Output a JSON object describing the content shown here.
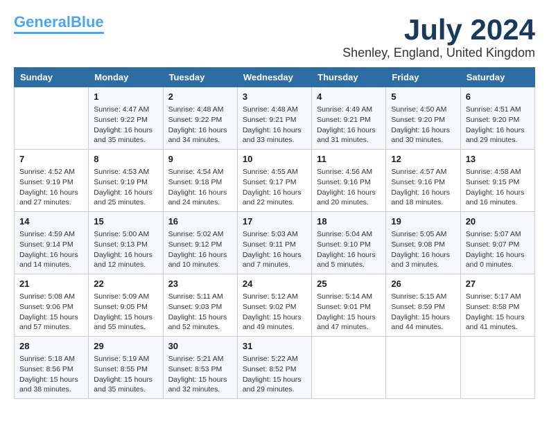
{
  "header": {
    "logo_line1": "General",
    "logo_line2": "Blue",
    "month": "July 2024",
    "location": "Shenley, England, United Kingdom"
  },
  "days_of_week": [
    "Sunday",
    "Monday",
    "Tuesday",
    "Wednesday",
    "Thursday",
    "Friday",
    "Saturday"
  ],
  "weeks": [
    [
      {
        "day": "",
        "content": ""
      },
      {
        "day": "1",
        "content": "Sunrise: 4:47 AM\nSunset: 9:22 PM\nDaylight: 16 hours\nand 35 minutes."
      },
      {
        "day": "2",
        "content": "Sunrise: 4:48 AM\nSunset: 9:22 PM\nDaylight: 16 hours\nand 34 minutes."
      },
      {
        "day": "3",
        "content": "Sunrise: 4:48 AM\nSunset: 9:21 PM\nDaylight: 16 hours\nand 33 minutes."
      },
      {
        "day": "4",
        "content": "Sunrise: 4:49 AM\nSunset: 9:21 PM\nDaylight: 16 hours\nand 31 minutes."
      },
      {
        "day": "5",
        "content": "Sunrise: 4:50 AM\nSunset: 9:20 PM\nDaylight: 16 hours\nand 30 minutes."
      },
      {
        "day": "6",
        "content": "Sunrise: 4:51 AM\nSunset: 9:20 PM\nDaylight: 16 hours\nand 29 minutes."
      }
    ],
    [
      {
        "day": "7",
        "content": "Sunrise: 4:52 AM\nSunset: 9:19 PM\nDaylight: 16 hours\nand 27 minutes."
      },
      {
        "day": "8",
        "content": "Sunrise: 4:53 AM\nSunset: 9:19 PM\nDaylight: 16 hours\nand 25 minutes."
      },
      {
        "day": "9",
        "content": "Sunrise: 4:54 AM\nSunset: 9:18 PM\nDaylight: 16 hours\nand 24 minutes."
      },
      {
        "day": "10",
        "content": "Sunrise: 4:55 AM\nSunset: 9:17 PM\nDaylight: 16 hours\nand 22 minutes."
      },
      {
        "day": "11",
        "content": "Sunrise: 4:56 AM\nSunset: 9:16 PM\nDaylight: 16 hours\nand 20 minutes."
      },
      {
        "day": "12",
        "content": "Sunrise: 4:57 AM\nSunset: 9:16 PM\nDaylight: 16 hours\nand 18 minutes."
      },
      {
        "day": "13",
        "content": "Sunrise: 4:58 AM\nSunset: 9:15 PM\nDaylight: 16 hours\nand 16 minutes."
      }
    ],
    [
      {
        "day": "14",
        "content": "Sunrise: 4:59 AM\nSunset: 9:14 PM\nDaylight: 16 hours\nand 14 minutes."
      },
      {
        "day": "15",
        "content": "Sunrise: 5:00 AM\nSunset: 9:13 PM\nDaylight: 16 hours\nand 12 minutes."
      },
      {
        "day": "16",
        "content": "Sunrise: 5:02 AM\nSunset: 9:12 PM\nDaylight: 16 hours\nand 10 minutes."
      },
      {
        "day": "17",
        "content": "Sunrise: 5:03 AM\nSunset: 9:11 PM\nDaylight: 16 hours\nand 7 minutes."
      },
      {
        "day": "18",
        "content": "Sunrise: 5:04 AM\nSunset: 9:10 PM\nDaylight: 16 hours\nand 5 minutes."
      },
      {
        "day": "19",
        "content": "Sunrise: 5:05 AM\nSunset: 9:08 PM\nDaylight: 16 hours\nand 3 minutes."
      },
      {
        "day": "20",
        "content": "Sunrise: 5:07 AM\nSunset: 9:07 PM\nDaylight: 16 hours\nand 0 minutes."
      }
    ],
    [
      {
        "day": "21",
        "content": "Sunrise: 5:08 AM\nSunset: 9:06 PM\nDaylight: 15 hours\nand 57 minutes."
      },
      {
        "day": "22",
        "content": "Sunrise: 5:09 AM\nSunset: 9:05 PM\nDaylight: 15 hours\nand 55 minutes."
      },
      {
        "day": "23",
        "content": "Sunrise: 5:11 AM\nSunset: 9:03 PM\nDaylight: 15 hours\nand 52 minutes."
      },
      {
        "day": "24",
        "content": "Sunrise: 5:12 AM\nSunset: 9:02 PM\nDaylight: 15 hours\nand 49 minutes."
      },
      {
        "day": "25",
        "content": "Sunrise: 5:14 AM\nSunset: 9:01 PM\nDaylight: 15 hours\nand 47 minutes."
      },
      {
        "day": "26",
        "content": "Sunrise: 5:15 AM\nSunset: 8:59 PM\nDaylight: 15 hours\nand 44 minutes."
      },
      {
        "day": "27",
        "content": "Sunrise: 5:17 AM\nSunset: 8:58 PM\nDaylight: 15 hours\nand 41 minutes."
      }
    ],
    [
      {
        "day": "28",
        "content": "Sunrise: 5:18 AM\nSunset: 8:56 PM\nDaylight: 15 hours\nand 38 minutes."
      },
      {
        "day": "29",
        "content": "Sunrise: 5:19 AM\nSunset: 8:55 PM\nDaylight: 15 hours\nand 35 minutes."
      },
      {
        "day": "30",
        "content": "Sunrise: 5:21 AM\nSunset: 8:53 PM\nDaylight: 15 hours\nand 32 minutes."
      },
      {
        "day": "31",
        "content": "Sunrise: 5:22 AM\nSunset: 8:52 PM\nDaylight: 15 hours\nand 29 minutes."
      },
      {
        "day": "",
        "content": ""
      },
      {
        "day": "",
        "content": ""
      },
      {
        "day": "",
        "content": ""
      }
    ]
  ]
}
